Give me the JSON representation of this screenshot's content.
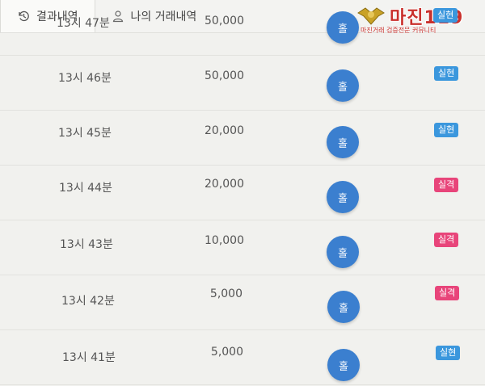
{
  "tabs": [
    {
      "label": "결과내역",
      "icon": "history-icon",
      "active": true
    },
    {
      "label": "나의 거래내역",
      "icon": "user-icon",
      "active": false
    }
  ],
  "watermark": {
    "title": "마진119",
    "subtitle": "마진거래 검증전문 커뮤니티"
  },
  "colors": {
    "button_blue": "#3b7fcf",
    "badge_win": "#3b97dd",
    "badge_lose": "#e8457a"
  },
  "rows": [
    {
      "time": "13시 47분",
      "amount": "50,000",
      "button": "홀",
      "result": "실현",
      "status": "win"
    },
    {
      "time": "13시 46분",
      "amount": "50,000",
      "button": "홀",
      "result": "실현",
      "status": "win"
    },
    {
      "time": "13시 45분",
      "amount": "20,000",
      "button": "홀",
      "result": "실현",
      "status": "win"
    },
    {
      "time": "13시 44분",
      "amount": "20,000",
      "button": "홀",
      "result": "실격",
      "status": "lose"
    },
    {
      "time": "13시 43분",
      "amount": "10,000",
      "button": "홀",
      "result": "실격",
      "status": "lose"
    },
    {
      "time": "13시 42분",
      "amount": "5,000",
      "button": "홀",
      "result": "실격",
      "status": "lose"
    },
    {
      "time": "13시 41분",
      "amount": "5,000",
      "button": "홀",
      "result": "실현",
      "status": "win"
    }
  ]
}
